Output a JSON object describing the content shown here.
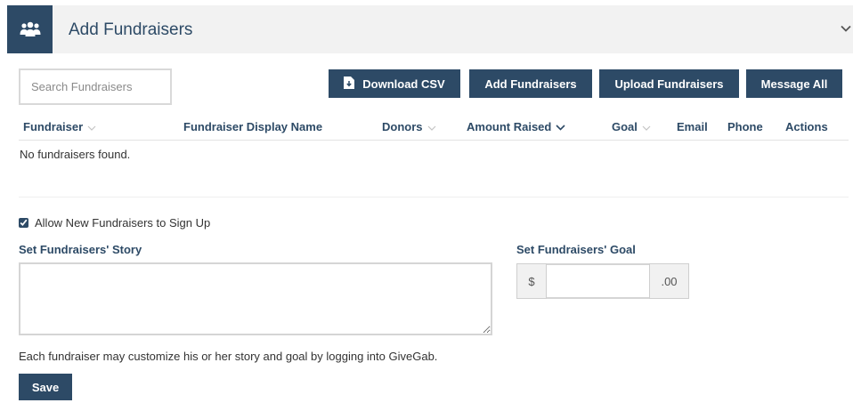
{
  "header": {
    "title": "Add Fundraisers",
    "icon": "people-group-icon",
    "collapse_icon": "chevron-down-icon"
  },
  "search": {
    "placeholder": "Search Fundraisers",
    "value": ""
  },
  "toolbar": {
    "download_csv_label": "Download CSV",
    "download_icon": "file-download-icon",
    "add_label": "Add Fundraisers",
    "upload_label": "Upload Fundraisers",
    "message_label": "Message All"
  },
  "table": {
    "columns": [
      {
        "label": "Fundraiser",
        "sort": "inactive"
      },
      {
        "label": "Fundraiser Display Name",
        "sort": "none"
      },
      {
        "label": "Donors",
        "sort": "inactive"
      },
      {
        "label": "Amount Raised",
        "sort": "active"
      },
      {
        "label": "Goal",
        "sort": "inactive"
      },
      {
        "label": "Email",
        "sort": "none"
      },
      {
        "label": "Phone",
        "sort": "none"
      },
      {
        "label": "Actions",
        "sort": "none"
      }
    ],
    "rows": [],
    "empty_text": "No fundraisers found."
  },
  "settings": {
    "allow_signup_label": "Allow New Fundraisers to Sign Up",
    "allow_signup_checked": true,
    "story_label": "Set Fundraisers' Story",
    "story_value": "",
    "goal_label": "Set Fundraisers' Goal",
    "goal_prefix": "$",
    "goal_value": "",
    "goal_suffix": ".00",
    "help_text": "Each fundraiser may customize his or her story and goal by logging into GiveGab.",
    "save_label": "Save"
  },
  "colors": {
    "primary": "#2d4a66",
    "header_bg": "#f2f2f2",
    "border": "#d5d5d5"
  }
}
